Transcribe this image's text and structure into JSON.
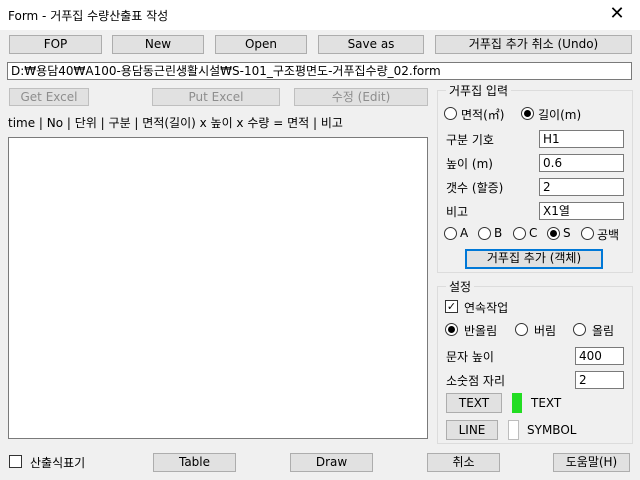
{
  "window": {
    "title": "Form - 거푸집 수량산출표 작성",
    "close_glyph": "✕"
  },
  "toolbar": {
    "fop": "FOP",
    "new": "New",
    "open": "Open",
    "save_as": "Save as",
    "undo": "거푸집 추가 취소 (Undo)"
  },
  "path": "D:₩용담40₩A100-용담동근린생활시설₩S-101_구조평면도-거푸집수량_02.form",
  "actions": {
    "get_excel": "Get Excel",
    "put_excel": "Put Excel",
    "edit": "수정 (Edit)"
  },
  "header_line": "time | No | 단위 | 구분 | 면적(길이) x 높이 x 수량 = 면적 | 비고",
  "input_group": {
    "title": "거푸집 입력",
    "area_radio": "면적(㎡)",
    "length_radio": "길이(m)",
    "mode_selected": "length",
    "symbol_label": "구분 기호",
    "symbol_value": "H1",
    "height_label": "높이 (m)",
    "height_value": "0.6",
    "count_label": "갯수 (할증)",
    "count_value": "2",
    "note_label": "비고",
    "note_value": "X1열",
    "options": [
      {
        "label": "A",
        "selected": false
      },
      {
        "label": "B",
        "selected": false
      },
      {
        "label": "C",
        "selected": false
      },
      {
        "label": "S",
        "selected": true
      },
      {
        "label": "공백",
        "selected": false
      }
    ],
    "add_button": "거푸집 추가 (객체)"
  },
  "settings_group": {
    "title": "설정",
    "continuous_label": "연속작업",
    "continuous_checked": true,
    "round_options": [
      {
        "label": "반올림",
        "selected": true
      },
      {
        "label": "버림",
        "selected": false
      },
      {
        "label": "올림",
        "selected": false
      }
    ],
    "text_height_label": "문자 높이",
    "text_height_value": "400",
    "decimal_label": "소숫점 자리",
    "decimal_value": "2",
    "text_button": "TEXT",
    "text_color": "#22dd22",
    "text_label": "TEXT",
    "line_button": "LINE",
    "line_color": "#ffffff",
    "symbol_label": "SYMBOL"
  },
  "bottom": {
    "calc_table_label": "산출식표기",
    "calc_table_checked": false,
    "table": "Table",
    "draw": "Draw",
    "cancel": "취소",
    "help": "도움말(H)"
  }
}
